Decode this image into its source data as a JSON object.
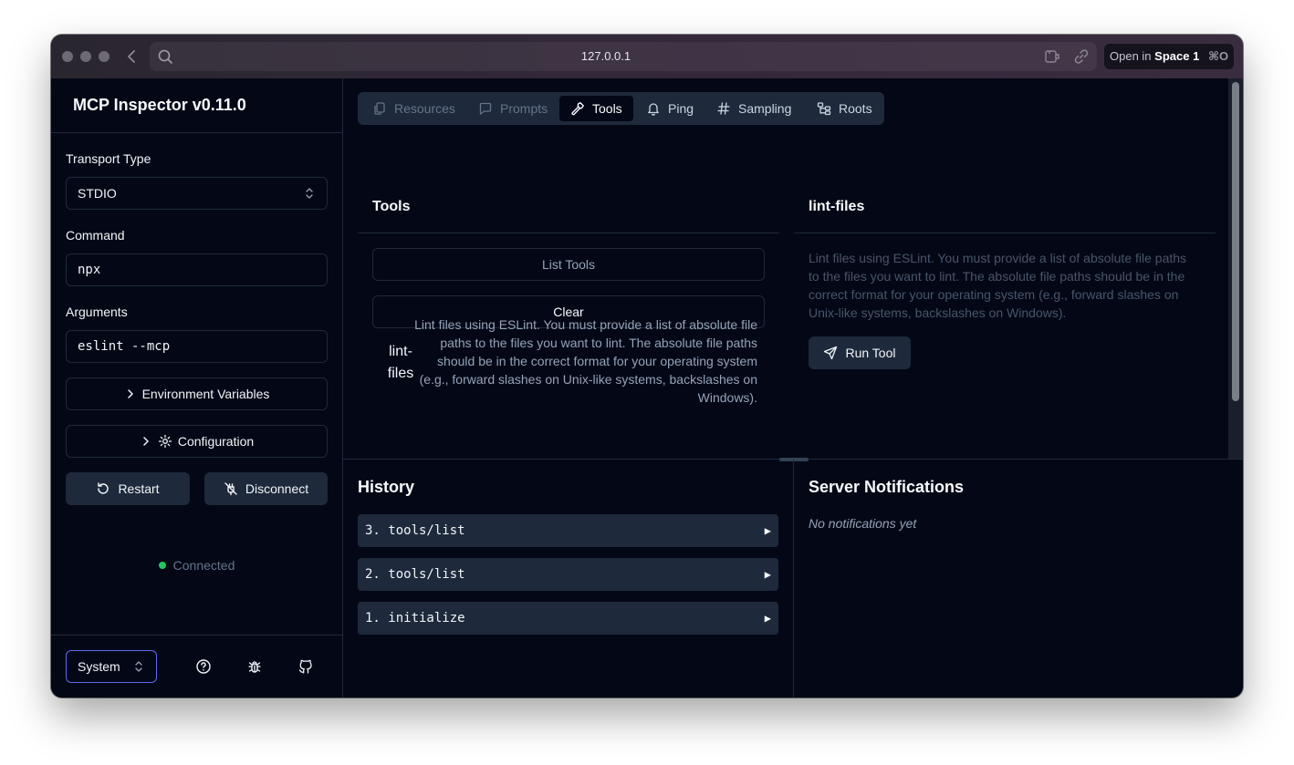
{
  "browser": {
    "url": "127.0.0.1",
    "open_in_prefix": "Open in",
    "open_in_target": "Space 1",
    "open_in_shortcut": "⌘O"
  },
  "sidebar": {
    "title": "MCP Inspector v0.11.0",
    "transport_label": "Transport Type",
    "transport_value": "STDIO",
    "command_label": "Command",
    "command_value": "npx",
    "arguments_label": "Arguments",
    "arguments_value": "eslint --mcp",
    "env_vars_label": "Environment Variables",
    "config_label": "Configuration",
    "restart_label": "Restart",
    "disconnect_label": "Disconnect",
    "status_text": "Connected",
    "status_color": "#22c55e",
    "theme_value": "System"
  },
  "tabs": [
    {
      "label": "Resources",
      "icon": "files-icon",
      "state": "disabled"
    },
    {
      "label": "Prompts",
      "icon": "message-square-icon",
      "state": "disabled"
    },
    {
      "label": "Tools",
      "icon": "hammer-icon",
      "state": "active"
    },
    {
      "label": "Ping",
      "icon": "bell-icon",
      "state": "normal"
    },
    {
      "label": "Sampling",
      "icon": "hash-icon",
      "state": "normal"
    },
    {
      "label": "Roots",
      "icon": "folder-tree-icon",
      "state": "normal"
    }
  ],
  "tools_panel": {
    "title": "Tools",
    "list_button": "List Tools",
    "clear_button": "Clear",
    "items": [
      {
        "name": "lint-files",
        "description": "Lint files using ESLint. You must provide a list of absolute file paths to the files you want to lint. The absolute file paths should be in the correct format for your operating system (e.g., forward slashes on Unix-like systems, backslashes on Windows)."
      }
    ]
  },
  "tool_detail": {
    "title": "lint-files",
    "description": "Lint files using ESLint. You must provide a list of absolute file paths to the files you want to lint. The absolute file paths should be in the correct format for your operating system (e.g., forward slashes on Unix-like systems, backslashes on Windows).",
    "run_button": "Run Tool"
  },
  "history": {
    "title": "History",
    "items": [
      {
        "label": "3. tools/list"
      },
      {
        "label": "2. tools/list"
      },
      {
        "label": "1. initialize"
      }
    ],
    "expand_glyph": "▶"
  },
  "notifications": {
    "title": "Server Notifications",
    "empty_text": "No notifications yet"
  }
}
